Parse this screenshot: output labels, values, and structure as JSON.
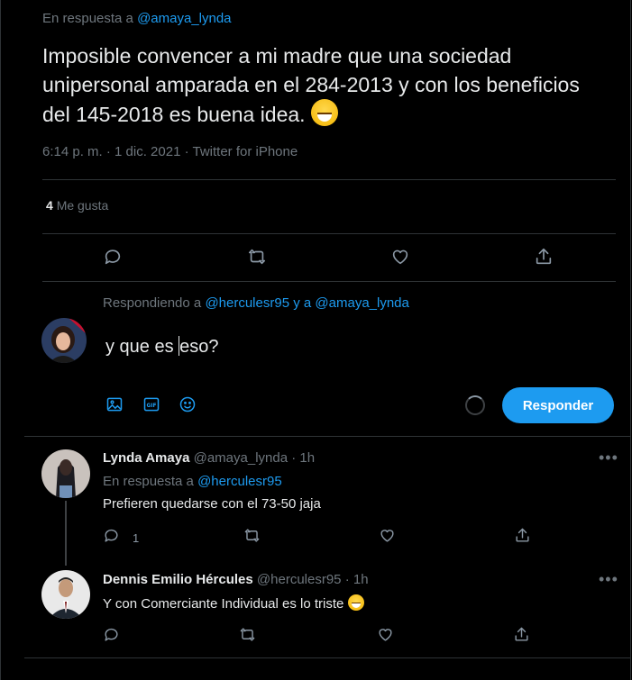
{
  "main_tweet": {
    "reply_prefix": "En respuesta a",
    "reply_handle": "@amaya_lynda",
    "text": "Imposible convencer a mi madre que una sociedad unipersonal amparada en el 284-2013 y con los beneficios del 145-2018 es buena idea.",
    "meta": "6:14 p. m. · 1 dic. 2021 · Twitter for iPhone",
    "likes_count": "4",
    "likes_label": "Me gusta"
  },
  "compose": {
    "replying_prefix": "Respondiendo a",
    "replying_handle_1": "@herculesr95",
    "replying_and": "y a",
    "replying_handle_2": "@amaya_lynda",
    "text_before_cursor": "y que es ",
    "text_after_cursor": "eso?",
    "reply_button": "Responder"
  },
  "replies": [
    {
      "name": "Lynda Amaya",
      "handle": "@amaya_lynda",
      "time": "· 1h",
      "reply_prefix": "En respuesta a",
      "reply_handle": "@herculesr95",
      "text": "Prefieren quedarse con el 73-50 jaja",
      "reply_count": "1"
    },
    {
      "name": "Dennis Emilio Hércules",
      "handle": "@herculesr95",
      "time": "· 1h",
      "text": "Y con Comerciante Individual es lo triste"
    }
  ],
  "colors": {
    "accent": "#1d9bf0",
    "background": "#000000",
    "muted": "#6e767d",
    "divider": "#2f3336"
  },
  "icons": [
    "reply-icon",
    "retweet-icon",
    "like-icon",
    "share-icon",
    "image-icon",
    "gif-icon",
    "emoji-icon",
    "more-icon",
    "grinning-sweat-emoji"
  ]
}
